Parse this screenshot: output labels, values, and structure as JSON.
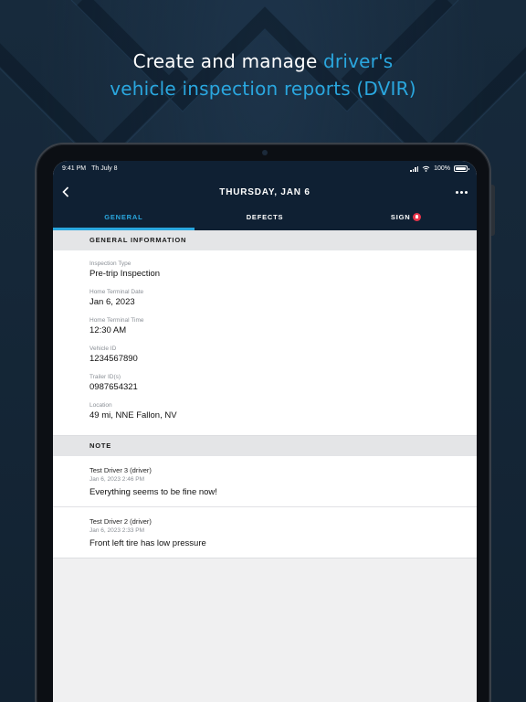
{
  "headline": {
    "line1_prefix": "Create and manage ",
    "line1_accent": "driver's",
    "line2": "vehicle inspection reports (DVIR)"
  },
  "status_bar": {
    "time": "9:41 PM",
    "date": "Th July 8",
    "battery": "100%"
  },
  "nav": {
    "title": "THURSDAY, JAN 6"
  },
  "tabs": [
    {
      "label": "GENERAL",
      "active": true
    },
    {
      "label": "DEFECTS",
      "active": false
    },
    {
      "label": "SIGN",
      "active": false,
      "alert": true
    }
  ],
  "general": {
    "header": "GENERAL INFORMATION",
    "fields": [
      {
        "label": "Inspection Type",
        "value": "Pre-trip Inspection"
      },
      {
        "label": "Home Terminal Date",
        "value": "Jan 6, 2023"
      },
      {
        "label": "Home Terminal Time",
        "value": "12:30 AM"
      },
      {
        "label": "Vehicle ID",
        "value": "1234567890"
      },
      {
        "label": "Trailer ID(s)",
        "value": "0987654321"
      },
      {
        "label": "Location",
        "value": "49 mi, NNE Fallon, NV"
      }
    ]
  },
  "notes": {
    "header": "NOTE",
    "items": [
      {
        "author": "Test Driver 3 (driver)",
        "timestamp": "Jan 6, 2023 2:46 PM",
        "text": "Everything seems to be fine now!"
      },
      {
        "author": "Test Driver 2 (driver)",
        "timestamp": "Jan 6, 2023 2:33 PM",
        "text": "Front left tire has low pressure"
      }
    ]
  },
  "colors": {
    "accent": "#2aa7df",
    "navy": "#0f2033",
    "alert": "#e8344a"
  }
}
